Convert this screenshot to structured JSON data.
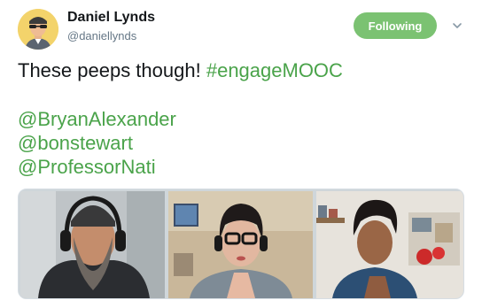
{
  "user": {
    "name": "Daniel Lynds",
    "handle": "@daniellynds"
  },
  "follow_button": {
    "label": "Following"
  },
  "tweet": {
    "text": "These peeps though!",
    "hashtag": "#engageMOOC",
    "mentions": [
      "@BryanAlexander",
      "@bonstewart",
      "@ProfessorNati"
    ]
  },
  "colors": {
    "accent": "#4aa34a",
    "follow_button": "#7bc272",
    "handle": "#657786"
  },
  "icons": {
    "menu": "chevron-down-icon"
  }
}
